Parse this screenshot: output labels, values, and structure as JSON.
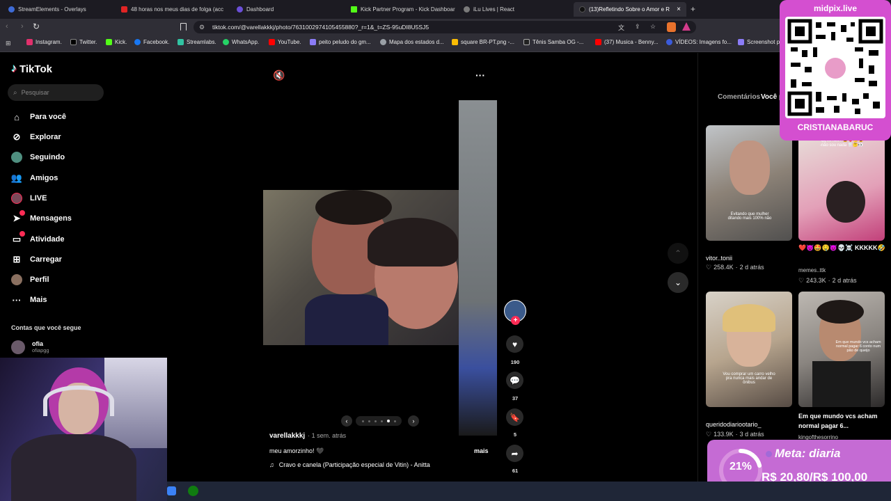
{
  "browser": {
    "tabs": [
      {
        "label": "StreamElements - Overlays",
        "color": "#3e6bd6",
        "active": false
      },
      {
        "label": "48 horas nos meus dias de folga (acc",
        "color": "#e02424",
        "active": false
      },
      {
        "label": "Dashboard",
        "color": "#6b4fd8",
        "active": false
      },
      {
        "label": "Kick Partner Program - Kick Dashboar",
        "color": "#53fc18",
        "active": false
      },
      {
        "label": "iLu Lives | React",
        "color": "#7a7a7a",
        "active": false
      },
      {
        "label": "(13)Refletindo Sobre o Amor e R",
        "color": "#222222",
        "active": true
      }
    ],
    "new_tab": "+",
    "close_tab": "×",
    "url": "tiktok.com/@varellakkkj/photo/7631002974105455880?_r=1&_t=ZS-95uDI8U5SJ5",
    "bookmarks": [
      {
        "label": "Instagram.",
        "color": "#e1306c"
      },
      {
        "label": "Twitter.",
        "color": "#000000"
      },
      {
        "label": "Kick.",
        "color": "#53fc18"
      },
      {
        "label": "Facebook.",
        "color": "#1877f2"
      },
      {
        "label": "Streamlabs.",
        "color": "#31c3a2"
      },
      {
        "label": "WhatsApp.",
        "color": "#25d366"
      },
      {
        "label": "YouTube.",
        "color": "#ff0000"
      },
      {
        "label": "peito peludo do gm...",
        "color": "#8b7cf6"
      },
      {
        "label": "Mapa dos estados d...",
        "color": "#9aa0a6"
      },
      {
        "label": "square BR-PT.png -...",
        "color": "#fbbc04"
      },
      {
        "label": "Tênis Samba OG -...",
        "color": "#222222"
      },
      {
        "label": "(37) Musica - Benny...",
        "color": "#ff0000"
      },
      {
        "label": "VÍDEOS: Imagens fo...",
        "color": "#3b5bdb"
      },
      {
        "label": "Screenshot p",
        "color": "#8b7cf6"
      }
    ]
  },
  "sidebar": {
    "logo": "TikTok",
    "search_placeholder": "Pesquisar",
    "items": [
      {
        "label": "Para você",
        "icon": "home-icon"
      },
      {
        "label": "Explorar",
        "icon": "compass-icon"
      },
      {
        "label": "Seguindo",
        "icon": "following-icon"
      },
      {
        "label": "Amigos",
        "icon": "friends-icon"
      },
      {
        "label": "LIVE",
        "icon": "live-icon"
      },
      {
        "label": "Mensagens",
        "icon": "messages-icon"
      },
      {
        "label": "Atividade",
        "icon": "activity-icon"
      },
      {
        "label": "Carregar",
        "icon": "upload-icon"
      },
      {
        "label": "Perfil",
        "icon": "profile-icon"
      },
      {
        "label": "Mais",
        "icon": "more-icon"
      }
    ],
    "following_header": "Contas que você segue",
    "following": [
      {
        "name": "ofia",
        "handle": "ofiapgg"
      }
    ]
  },
  "post": {
    "author": "varellakkkj",
    "time": "· 1 sem. atrás",
    "caption": "meu amorzinho! 🖤",
    "more": "mais",
    "music": "Cravo e canela (Participação especial de Vitin) - Anitta",
    "likes": "190",
    "comments": "37",
    "saves": "5",
    "shares": "61"
  },
  "panel": {
    "tabs": [
      "Comentários",
      "Você p"
    ],
    "videos": [
      {
        "caption": "Evitando que mulher ditando mais 100% não",
        "user": "vitor..tonii",
        "views": "258.4K",
        "time": "2 d atrás"
      },
      {
        "caption": "-qq eu falo? 😂❤️🤔😍\n-não sou nada 🦷🤔👀",
        "user": "memes..ttk",
        "views": "243.3K",
        "time": "2 d atrás",
        "title": "❤️😈🤩🤤😈💀☠️ KKKKK🤣😂😂..."
      },
      {
        "caption": "Vou comprar um carro velho pra nunca mais andar de ônibus",
        "user": "queridodiariootario_",
        "views": "133.9K",
        "time": "3 d atrás"
      },
      {
        "caption": "Em que mundo vcs acham normal pagar 6 conto num pão de queijo",
        "user": "kingofthesorrino",
        "views": "",
        "time": "",
        "title": "Em que mundo vcs acham normal pagar 6..."
      }
    ]
  },
  "overlays": {
    "qr_title": "midpix.live",
    "qr_name": "CRISTIANABARUC",
    "goal_title": "Meta: diaria",
    "goal_value": "R$ 20,80/R$ 100,00",
    "goal_percent_label": "21%",
    "goal_progress": 0.21
  },
  "colors": {
    "tiktok_red": "#fe2c55",
    "overlay_pink": "#d44fd0",
    "goal_bg": "#c56bd4"
  }
}
